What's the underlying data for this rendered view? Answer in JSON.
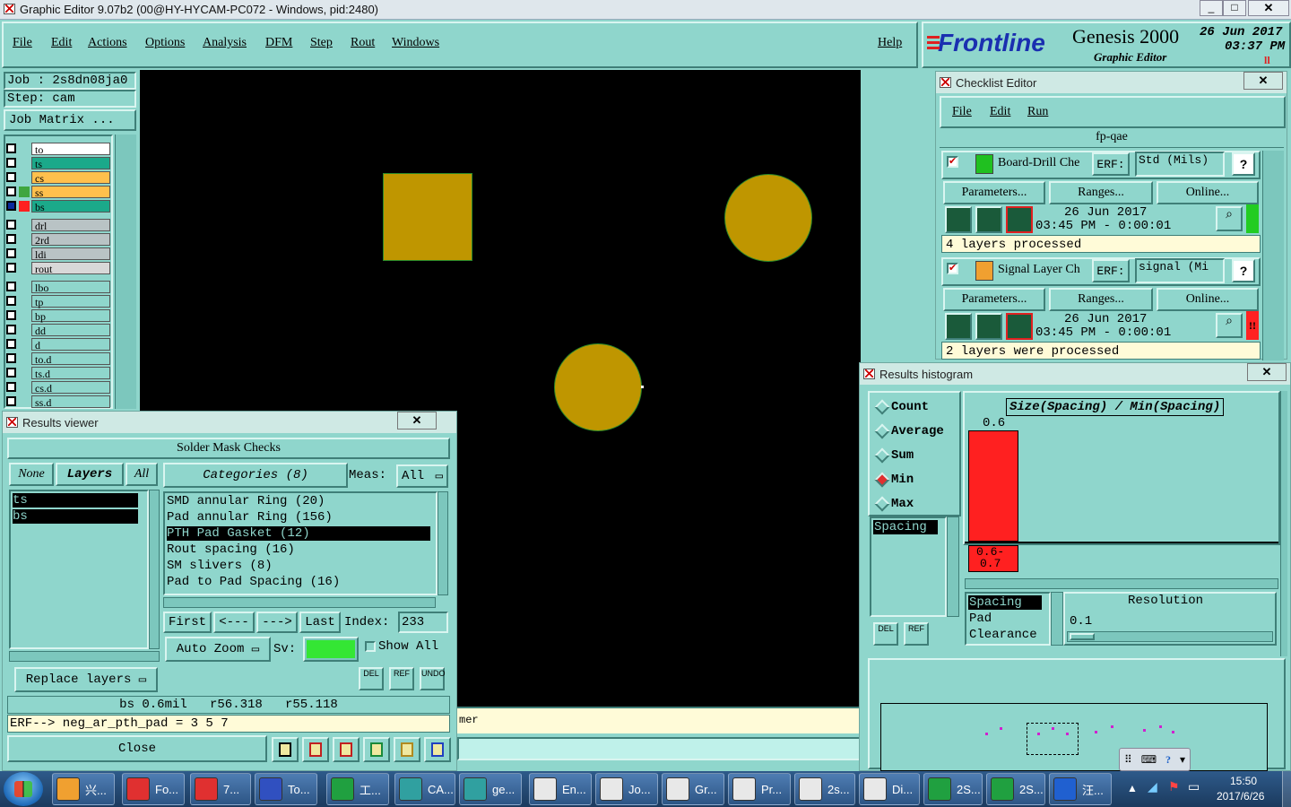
{
  "window_title": "Graphic Editor 9.07b2 (00@HY-HYCAM-PC072 - Windows, pid:2480)",
  "menu": [
    "File",
    "Edit",
    "Actions",
    "Options",
    "Analysis",
    "DFM",
    "Step",
    "Rout",
    "Windows"
  ],
  "help_label": "Help",
  "brand": {
    "logo": "Frontline",
    "product": "Genesis 2000",
    "sub": "Graphic Editor",
    "date": "26 Jun 2017",
    "time": "03:37 PM",
    "pause": "ll"
  },
  "job": {
    "job": "Job : 2s8dn08ja0",
    "step": "Step: cam",
    "matrix": "Job Matrix ..."
  },
  "layers": [
    {
      "name": "to",
      "color": "#ffffff"
    },
    {
      "name": "ts",
      "color": "#1ba98a"
    },
    {
      "name": "cs",
      "color": "#ffc04d"
    },
    {
      "name": "ss",
      "color": "#ffc04d"
    },
    {
      "name": "bs",
      "color": "#1ba98a"
    },
    {
      "name": "drl",
      "color": "#b9c3c5"
    },
    {
      "name": "2rd",
      "color": "#b9c3c5"
    },
    {
      "name": "ldi",
      "color": "#b9c3c5"
    },
    {
      "name": "rout",
      "color": "#d8d8d8"
    },
    {
      "name": "lbo",
      "color": "#8fd6cc"
    },
    {
      "name": "tp",
      "color": "#8fd6cc"
    },
    {
      "name": "bp",
      "color": "#8fd6cc"
    },
    {
      "name": "dd",
      "color": "#8fd6cc"
    },
    {
      "name": "d",
      "color": "#8fd6cc"
    },
    {
      "name": "to.d",
      "color": "#8fd6cc"
    },
    {
      "name": "ts.d",
      "color": "#8fd6cc"
    },
    {
      "name": "cs.d",
      "color": "#8fd6cc"
    },
    {
      "name": "ss.d",
      "color": "#8fd6cc"
    }
  ],
  "checklist": {
    "title": "Checklist Editor",
    "menu": [
      "File",
      "Edit",
      "Run"
    ],
    "name": "fp-qae",
    "items": [
      {
        "label": "Board-Drill Che",
        "erf_btn": "ERF:",
        "erf_val": "Std (Mils)",
        "params": "Parameters...",
        "ranges": "Ranges...",
        "online": "Online...",
        "date": "26 Jun 2017",
        "time": "03:45 PM - 0:00:01",
        "status": "4 layers processed",
        "status_color": "#22cc22",
        "status_mark": ""
      },
      {
        "label": "Signal Layer Ch",
        "erf_btn": "ERF:",
        "erf_val": "signal (Mi",
        "params": "Parameters...",
        "ranges": "Ranges...",
        "online": "Online...",
        "date": "26 Jun 2017",
        "time": "03:45 PM - 0:00:01",
        "status": "2 layers were processed",
        "status_color": "#ff2222",
        "status_mark": "!!"
      }
    ]
  },
  "results_viewer": {
    "title": "Results viewer",
    "header": "Solder Mask Checks",
    "none": "None",
    "layers_btn": "Layers",
    "all": "All",
    "categories_btn": "Categories (8)",
    "meas_label": "Meas:",
    "meas_val": "All",
    "layer_list": [
      "ts",
      "bs"
    ],
    "categories": [
      "SMD annular Ring (20)",
      "Pad annular Ring (156)",
      "PTH Pad Gasket (12)",
      "Rout spacing (16)",
      "SM slivers (8)",
      "Pad to Pad Spacing (16)"
    ],
    "selected_category": 2,
    "first": "First",
    "prev": "<---",
    "next": "--->",
    "last": "Last",
    "index_label": "Index:",
    "index_val": "233",
    "auto_zoom": "Auto Zoom",
    "sv_label": "Sv:",
    "show_all": "Show All",
    "replace_layers": "Replace layers",
    "del": "DEL",
    "ref": "REF",
    "undo": "UNDO",
    "measure": "bs 0.6mil   r56.318   r55.118",
    "erf": "ERF--> neg_ar_pth_pad = 3 5 7",
    "close": "Close"
  },
  "histogram": {
    "title": "Results histogram",
    "modes": [
      "Count",
      "Average",
      "Sum",
      "Min",
      "Max"
    ],
    "selected_mode": "Min",
    "chart_title": "Size(Spacing) / Min(Spacing)",
    "bar_value": "0.6",
    "bar_range": "0.6-\n0.7",
    "list1": [
      "Spacing"
    ],
    "list2": [
      "Spacing",
      "Pad",
      "Clearance"
    ],
    "resolution_label": "Resolution",
    "resolution_val": "0.1",
    "del": "DEL",
    "ref": "REF"
  },
  "status_partial": "mer",
  "taskbar": {
    "items": [
      {
        "label": "兴...",
        "color": "#f0a030"
      },
      {
        "label": "Fo...",
        "color": "#e03030"
      },
      {
        "label": "7...",
        "color": "#e03030"
      },
      {
        "label": "To...",
        "color": "#3050c0"
      },
      {
        "label": "工...",
        "color": "#20a040"
      },
      {
        "label": "CA...",
        "color": "#30a0a0"
      },
      {
        "label": "ge...",
        "color": "#30a0a0"
      },
      {
        "label": "En...",
        "color": "#e8e8e8"
      },
      {
        "label": "Jo...",
        "color": "#e8e8e8"
      },
      {
        "label": "Gr...",
        "color": "#e8e8e8"
      },
      {
        "label": "Pr...",
        "color": "#e8e8e8"
      },
      {
        "label": "2s...",
        "color": "#e8e8e8"
      },
      {
        "label": "Di...",
        "color": "#e8e8e8"
      },
      {
        "label": "2S...",
        "color": "#20a040"
      },
      {
        "label": "2S...",
        "color": "#20a040"
      },
      {
        "label": "汪...",
        "color": "#2060d0"
      }
    ],
    "time": "15:50",
    "date": "2017/6/26"
  }
}
